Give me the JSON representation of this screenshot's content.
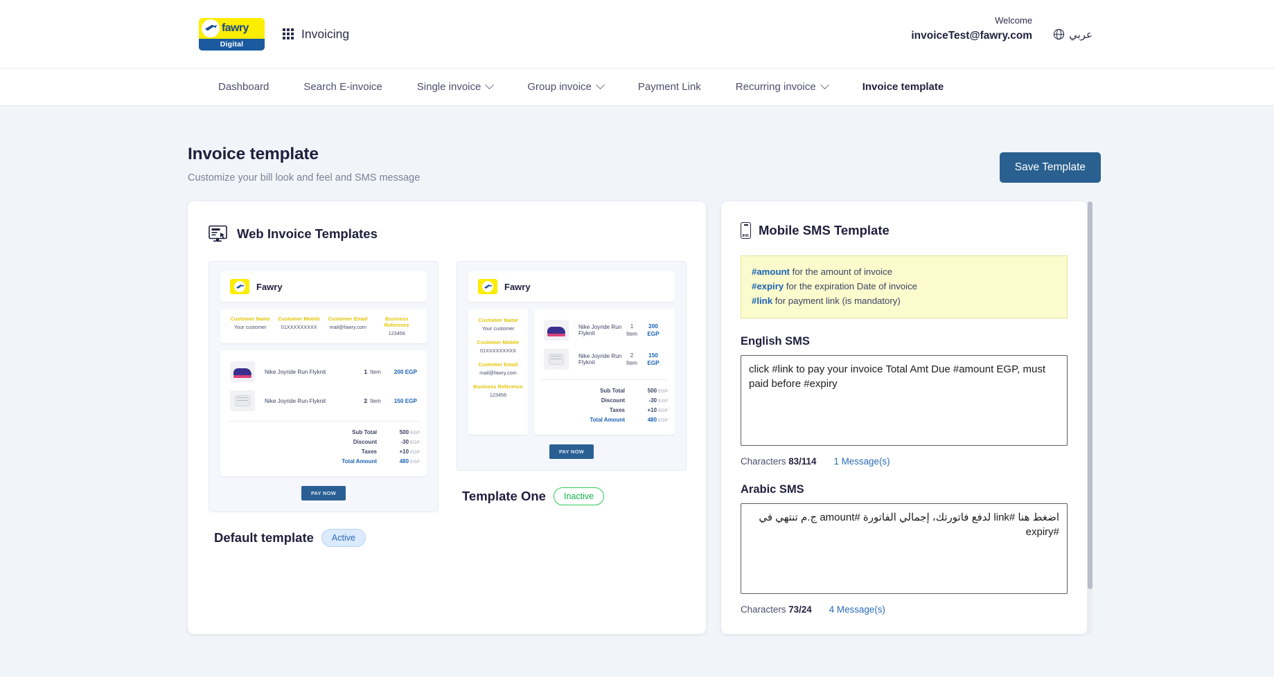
{
  "header": {
    "logo_word": "fawry",
    "logo_sub": "Digital",
    "app_title": "Invoicing",
    "welcome_label": "Welcome",
    "user_email": "invoiceTest@fawry.com",
    "lang_toggle": "عربي"
  },
  "nav": {
    "items": [
      {
        "label": "Dashboard",
        "has_caret": false,
        "active": false
      },
      {
        "label": "Search E-invoice",
        "has_caret": false,
        "active": false
      },
      {
        "label": "Single invoice",
        "has_caret": true,
        "active": false
      },
      {
        "label": "Group invoice",
        "has_caret": true,
        "active": false
      },
      {
        "label": "Payment Link",
        "has_caret": false,
        "active": false
      },
      {
        "label": "Recurring invoice",
        "has_caret": true,
        "active": false
      },
      {
        "label": "Invoice template",
        "has_caret": false,
        "active": true
      }
    ]
  },
  "page": {
    "title": "Invoice template",
    "subtitle": "Customize your bill look and feel and SMS message",
    "save_button": "Save Template"
  },
  "web_templates": {
    "card_title": "Web Invoice Templates",
    "brand": "Fawry",
    "customer_fields": [
      {
        "label": "Customer Name",
        "value": "Your customer"
      },
      {
        "label": "Customer Mobile",
        "value": "01XXXXXXXXX"
      },
      {
        "label": "Customer Email",
        "value": "mail@fawry.com"
      },
      {
        "label": "Business Reference",
        "value": "123456"
      }
    ],
    "items": [
      {
        "name": "Nike Joyride Run Flyknit",
        "qty": "1",
        "unit": "Item",
        "price": "200",
        "currency": "EGP"
      },
      {
        "name": "Nike Joyride Run Flyknit",
        "qty": "2",
        "unit": "Item",
        "price": "150",
        "currency": "EGP"
      }
    ],
    "totals": [
      {
        "label": "Sub Total",
        "value": "500",
        "currency": "EGP"
      },
      {
        "label": "Discount",
        "value": "-30",
        "currency": "EGP"
      },
      {
        "label": "Taxes",
        "value": "+10",
        "currency": "EGP"
      },
      {
        "label": "Total Amount",
        "value": "480",
        "currency": "EGP"
      }
    ],
    "pay_button": "PAY NOW",
    "templates": [
      {
        "name": "Default template",
        "status": "Active"
      },
      {
        "name": "Template One",
        "status": "Inactive"
      }
    ]
  },
  "sms": {
    "card_title": "Mobile SMS Template",
    "hints": [
      {
        "token": "#amount",
        "text": "for the amount of invoice"
      },
      {
        "token": "#expiry",
        "text": "for the expiration Date of invoice"
      },
      {
        "token": "#link",
        "text": "for payment link (is mandatory)"
      }
    ],
    "english": {
      "label": "English SMS",
      "value": "click #link to pay your invoice Total Amt Due #amount EGP, must paid before #expiry",
      "characters_label": "Characters",
      "characters_count": "83/114",
      "messages": "1 Message(s)"
    },
    "arabic": {
      "label": "Arabic SMS",
      "value": "اضغط هنا #link لدفع فاتورتك، إجمالي الفاتورة #amount ج.م تنتهي في #expiry",
      "characters_label": "Characters",
      "characters_count": "73/24",
      "messages": "4 Message(s)"
    }
  },
  "colors": {
    "brand_yellow": "#fded00",
    "brand_blue": "#17478c",
    "accent_blue": "#29608f",
    "active_pill": "#2a6bb5",
    "inactive_pill": "#12b347",
    "hint_bg": "#fbfbcd"
  }
}
